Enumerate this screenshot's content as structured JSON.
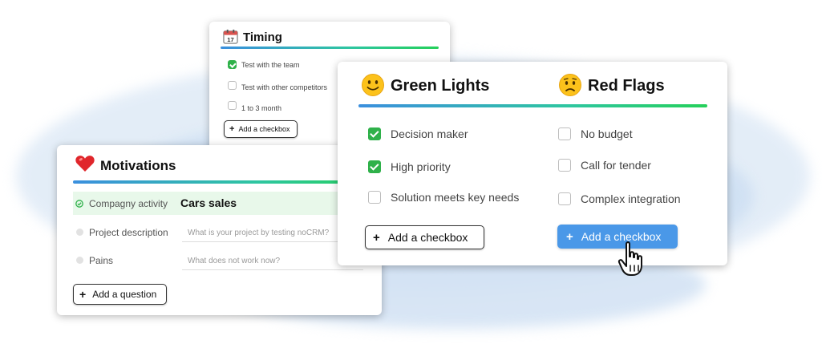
{
  "timing": {
    "icon": "calendar-icon",
    "title": "Timing",
    "items": [
      {
        "label": "Test with the team",
        "checked": true
      },
      {
        "label": "Test with other competitors",
        "checked": false
      },
      {
        "label": "1 to 3 month",
        "checked": false
      }
    ],
    "add_button": {
      "plus": "+",
      "label": "Add a checkbox"
    }
  },
  "motivations": {
    "icon": "heart-icon",
    "title": "Motivations",
    "rows": [
      {
        "label": "Compagny activity",
        "value": "Cars sales",
        "placeholder": ""
      },
      {
        "label": "Project description",
        "value": "",
        "placeholder": "What is your project by testing noCRM?"
      },
      {
        "label": "Pains",
        "value": "",
        "placeholder": "What does not work now?"
      }
    ],
    "add_button": {
      "plus": "+",
      "label": "Add a question"
    }
  },
  "main": {
    "green": {
      "icon": "slightly-smiling-face-icon",
      "title": "Green Lights",
      "items": [
        {
          "label": "Decision maker",
          "checked": true
        },
        {
          "label": "High priority",
          "checked": true
        },
        {
          "label": "Solution meets key needs",
          "checked": false
        }
      ],
      "add_button": {
        "plus": "+",
        "label": "Add a checkbox"
      }
    },
    "red": {
      "icon": "worried-face-icon",
      "title": "Red Flags",
      "items": [
        {
          "label": "No budget",
          "checked": false
        },
        {
          "label": "Call for tender",
          "checked": false
        },
        {
          "label": "Complex integration",
          "checked": false
        }
      ],
      "add_button": {
        "plus": "+",
        "label": "Add a checkbox"
      }
    }
  },
  "colors": {
    "check_green": "#2fb14a",
    "primary_button": "#4a98e8",
    "wash_blue": "#c9dcf1",
    "active_row": "#e8f8ea"
  },
  "cursor": "hand-pointer-icon"
}
